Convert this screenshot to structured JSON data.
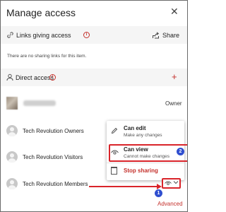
{
  "panel": {
    "title": "Manage access",
    "close_glyph": "✕"
  },
  "links_section": {
    "icon": "link-icon",
    "label": "Links giving access",
    "info_glyph": "i",
    "share_icon": "share-icon",
    "share_label": "Share",
    "empty_text": "There are no sharing links for this item."
  },
  "direct_section": {
    "icon": "person-icon",
    "label": "Direct access",
    "info_glyph": "i",
    "add_glyph": "+"
  },
  "members": [
    {
      "name": "",
      "role": "Owner"
    },
    {
      "name": "Tech Revolution Owners"
    },
    {
      "name": "Tech Revolution Visitors"
    },
    {
      "name": "Tech Revolution Members"
    }
  ],
  "permission_menu": {
    "options": [
      {
        "icon": "pencil-icon",
        "title": "Can edit",
        "subtitle": "Make any changes"
      },
      {
        "icon": "eye-icon",
        "title": "Can view",
        "subtitle": "Cannot make changes"
      }
    ],
    "stop_label": "Stop sharing"
  },
  "dropdown": {
    "eye_icon": "eye-icon",
    "chevron_icon": "chevron-down-icon"
  },
  "annotations": {
    "badge_1": "1",
    "badge_2": "2",
    "highlight_color": "#d9242a",
    "badge_color": "#2f4ecf"
  },
  "footer": {
    "advanced_label": "Advanced"
  },
  "colors": {
    "accent_red": "#c4302b",
    "section_band": "#f5f5f5"
  }
}
